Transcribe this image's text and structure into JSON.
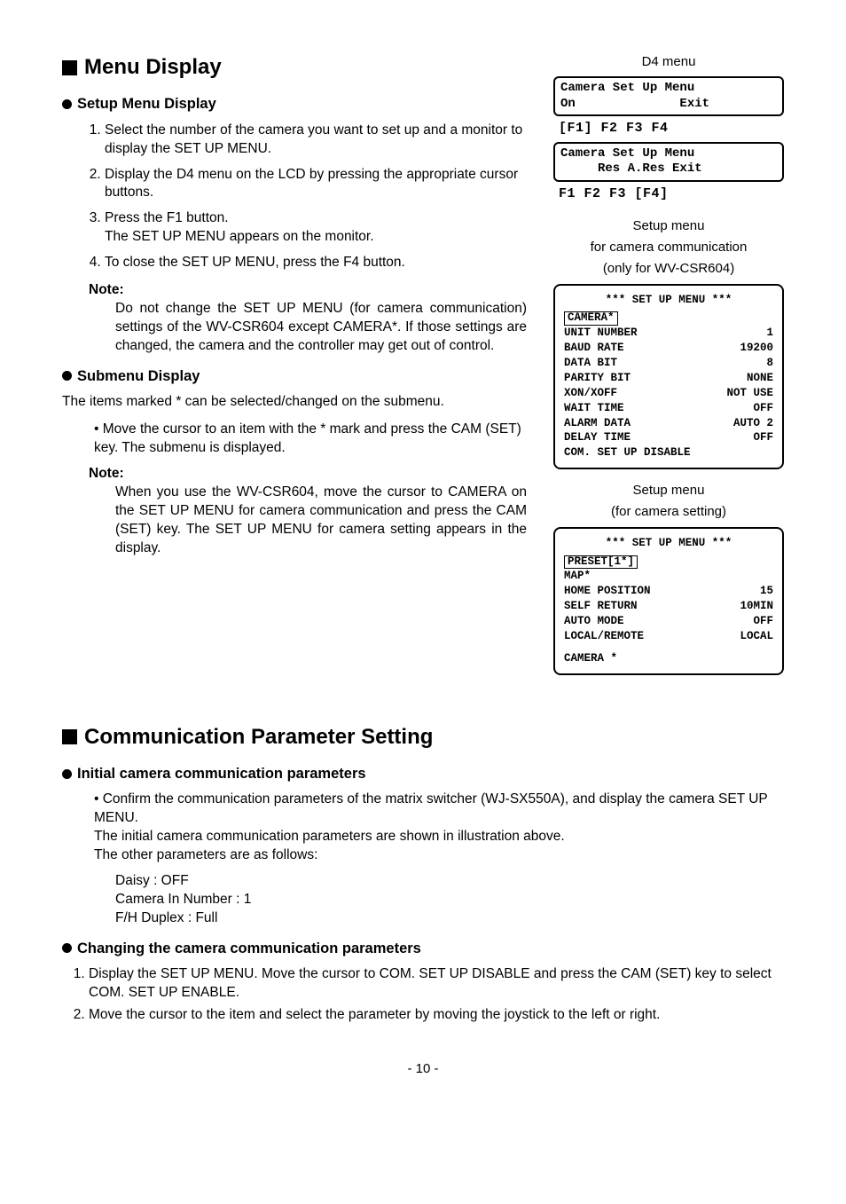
{
  "menuDisplay": {
    "heading": "Menu Display",
    "setup": {
      "heading": "Setup Menu Display",
      "li1": "Select the number of the camera you want to set up and a monitor to display the SET UP MENU.",
      "li2": "Display the D4 menu on the LCD by pressing the appropriate cursor buttons.",
      "li3a": "Press the F1 button.",
      "li3b": "The SET UP MENU appears on the monitor.",
      "li4": "To close the SET UP MENU, press the F4 button.",
      "noteLabel": "Note:",
      "noteBody": "Do not change the SET UP MENU (for camera communication) settings of the WV-CSR604 except CAMERA*. If those settings are changed, the camera and the controller may get out of control."
    },
    "submenu": {
      "heading": "Submenu Display",
      "intro": "The items marked * can be selected/changed on the submenu.",
      "bullet": "Move the cursor to an item with the * mark and press the CAM (SET) key.  The submenu is displayed.",
      "noteLabel": "Note:",
      "noteBody": "When you use the WV-CSR604, move the cursor to CAMERA on the SET UP MENU for camera communication and press the CAM (SET) key.  The SET UP MENU for camera setting appears in the display."
    }
  },
  "rightCol": {
    "d4menuLabel": "D4 menu",
    "box1line1": "Camera Set Up Menu",
    "box1line2": "On              Exit",
    "fkeys1": "[F1]  F2   F3   F4",
    "box2line1": "Camera Set Up Menu",
    "box2line2": "     Res A.Res Exit",
    "fkeys2": " F1   F2   F3  [F4]",
    "cap1a": "Setup menu",
    "cap1b": "for camera communication",
    "cap1c": "(only for WV-CSR604)",
    "screen1": {
      "hdr": "*** SET UP MENU ***",
      "camera": "CAMERA*",
      "rows": [
        {
          "k": " UNIT NUMBER",
          "v": "1"
        },
        {
          "k": " BAUD RATE",
          "v": "19200"
        },
        {
          "k": " DATA BIT",
          "v": "8"
        },
        {
          "k": " PARITY BIT",
          "v": "NONE"
        },
        {
          "k": " XON/XOFF",
          "v": "NOT USE"
        },
        {
          "k": " WAIT TIME",
          "v": "OFF"
        },
        {
          "k": " ALARM DATA",
          "v": "AUTO 2"
        },
        {
          "k": " DELAY TIME",
          "v": "OFF"
        }
      ],
      "footer": "COM. SET UP DISABLE"
    },
    "cap2a": "Setup menu",
    "cap2b": "(for camera setting)",
    "screen2": {
      "hdr": "*** SET UP MENU ***",
      "preset": "PRESET[1*]",
      "map": " MAP*",
      "rows": [
        {
          "k": " HOME POSITION",
          "v": "15"
        },
        {
          "k": " SELF RETURN",
          "v": "10MIN"
        },
        {
          "k": " AUTO MODE",
          "v": "OFF"
        },
        {
          "k": " LOCAL/REMOTE",
          "v": "LOCAL"
        }
      ],
      "camera": "CAMERA *"
    }
  },
  "comm": {
    "heading": "Communication Parameter Setting",
    "init": {
      "heading": "Initial camera communication parameters",
      "bullet": "Confirm the communication parameters of the matrix switcher (WJ-SX550A), and display the camera SET UP MENU.",
      "line2": "The initial camera communication parameters are shown in illustration above.",
      "line3": "The other parameters are as follows:",
      "p1": "Daisy : OFF",
      "p2": "Camera In Number : 1",
      "p3": "F/H Duplex : Full"
    },
    "change": {
      "heading": "Changing the camera communication parameters",
      "li1": "Display the SET UP MENU.  Move the cursor to COM. SET UP DISABLE and press the CAM (SET) key to select COM. SET UP ENABLE.",
      "li2": "Move the cursor to the item and select the parameter by moving the joystick to the left or right."
    }
  },
  "pageNum": "- 10 -"
}
